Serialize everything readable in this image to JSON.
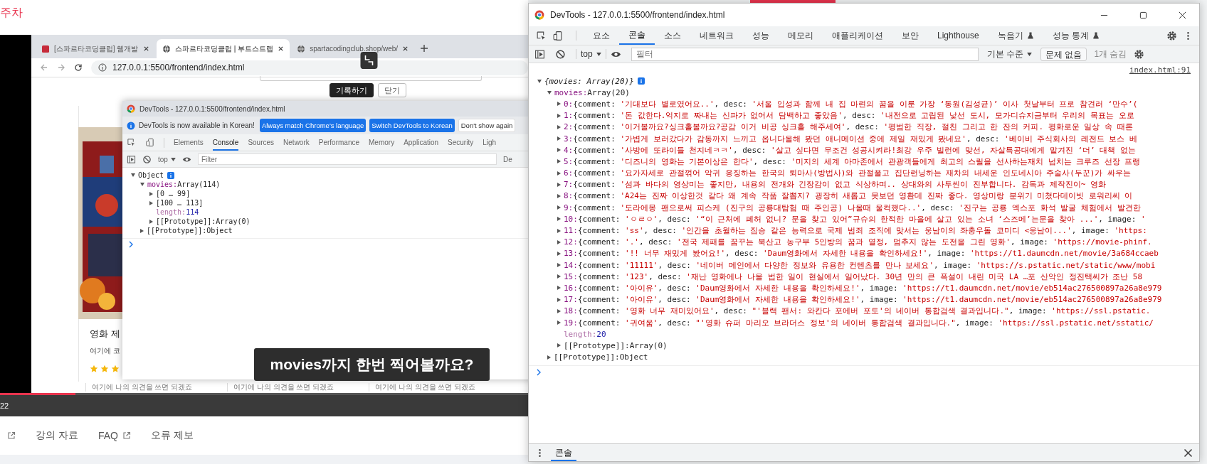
{
  "lecture_header": {
    "title": "주차"
  },
  "video": {
    "browser": {
      "tabs": [
        {
          "label": "[스파르타코딩클럽] 웹개발",
          "selected": false,
          "kind": "book"
        },
        {
          "label": "스파르타코딩클럽 | 부트스트랩",
          "selected": true,
          "kind": "globe"
        },
        {
          "label": "spartacodingclub.shop/web/",
          "selected": false,
          "kind": "globe"
        }
      ],
      "address": "127.0.0.1:5500/frontend/index.html",
      "page": {
        "buttons": [
          {
            "label": "기록하기",
            "kind": "dark"
          },
          {
            "label": "닫기",
            "kind": "light"
          }
        ],
        "card": {
          "title": "영화 제",
          "comment": "여기에 코",
          "stars": 3
        },
        "card_comments": [
          "여기에 나의 의견을 쓰면 되겠죠",
          "여기에 나의 의견을 쓰면 되겠죠",
          "여기에 나의 의견을 쓰면 되겠죠"
        ]
      }
    },
    "inner_devtools": {
      "title": "DevTools - 127.0.0.1:5500/frontend/index.html",
      "notice": "DevTools is now available in Korean!",
      "notice_buttons": [
        {
          "label": "Always match Chrome's language",
          "kind": "primary"
        },
        {
          "label": "Switch DevTools to Korean",
          "kind": "primary"
        },
        {
          "label": "Don't show again",
          "kind": "plain"
        }
      ],
      "tabs": [
        {
          "label": "Elements",
          "selected": false
        },
        {
          "label": "Console",
          "selected": true
        },
        {
          "label": "Sources",
          "selected": false
        },
        {
          "label": "Network",
          "selected": false
        },
        {
          "label": "Performance",
          "selected": false
        },
        {
          "label": "Memory",
          "selected": false
        },
        {
          "label": "Application",
          "selected": false
        },
        {
          "label": "Security",
          "selected": false
        },
        {
          "label": "Ligh",
          "selected": false
        }
      ],
      "context": "top",
      "filter_placeholder": "Filter",
      "levels": "De",
      "tree": [
        {
          "key": "Object",
          "kind": "plain",
          "info": true,
          "expanded": true,
          "children": [
            {
              "key": "movies:",
              "kind": "prop",
              "value": "Array(114)",
              "expanded": true,
              "children": [
                {
                  "key": "[0 … 99]",
                  "kind": "plain",
                  "expanded": false
                },
                {
                  "key": "[100 … 113]",
                  "kind": "plain",
                  "expanded": false
                },
                {
                  "key": "length:",
                  "kind": "meta",
                  "value": "114"
                },
                {
                  "key": "[[Prototype]]:",
                  "kind": "plain",
                  "value": "Array(0)",
                  "expanded": false
                }
              ]
            },
            {
              "key": "[[Prototype]]:",
              "kind": "plain",
              "value": "Object",
              "expanded": false
            }
          ]
        }
      ]
    },
    "caption": "movies까지 한번 찍어볼까요?",
    "progress": {
      "level": 0.143
    },
    "time": "22"
  },
  "footer_links": [
    {
      "label": "강의 자료",
      "external": false
    },
    {
      "label": "FAQ",
      "external": true
    },
    {
      "label": "오류 제보",
      "external": false
    }
  ],
  "devtools": {
    "title": "DevTools - 127.0.0.1:5500/frontend/index.html",
    "tabs": [
      {
        "label": "요소",
        "selected": false,
        "experimental": false
      },
      {
        "label": "콘솔",
        "selected": true,
        "experimental": false
      },
      {
        "label": "소스",
        "selected": false,
        "experimental": false
      },
      {
        "label": "네트워크",
        "selected": false,
        "experimental": false
      },
      {
        "label": "성능",
        "selected": false,
        "experimental": false
      },
      {
        "label": "메모리",
        "selected": false,
        "experimental": false
      },
      {
        "label": "애플리케이션",
        "selected": false,
        "experimental": false
      },
      {
        "label": "보안",
        "selected": false,
        "experimental": false
      },
      {
        "label": "Lighthouse",
        "selected": false,
        "experimental": false
      },
      {
        "label": "녹음기",
        "selected": false,
        "experimental": true
      },
      {
        "label": "성능 통계",
        "selected": false,
        "experimental": true
      }
    ],
    "context": "top",
    "filter_placeholder": "필터",
    "levels": "기본 수준",
    "issues": "문제 없음",
    "hidden": "1개 숨김",
    "source": "index.html:91",
    "tree": [
      {
        "key": "{movies: Array(20)}",
        "kind": "summary",
        "info": true,
        "expanded": true,
        "children": [
          {
            "key": "movies:",
            "kind": "prop",
            "value": "Array(20)",
            "expanded": true,
            "children": [
              {
                "key": "0:",
                "kind": "index",
                "expanded": false,
                "parts": [
                  {
                    "kind": "p",
                    "text": "{comment: "
                  },
                  {
                    "kind": "s",
                    "text": "'기대보다 별로였어요..'"
                  },
                  {
                    "kind": "p",
                    "text": ", desc: "
                  },
                  {
                    "kind": "s",
                    "text": "'서울 입성과 함께 내 집 마련의 꿈을 이룬 가장 ‘동원(김성균)’ 이사 첫날부터 프로 참견러 ‘만수’("
                  }
                ]
              },
              {
                "key": "1:",
                "kind": "index",
                "expanded": false,
                "parts": [
                  {
                    "kind": "p",
                    "text": "{comment: "
                  },
                  {
                    "kind": "s",
                    "text": "'돈 값한다.억지로 짜내는 신파가 없어서 담백하고 좋았음'"
                  },
                  {
                    "kind": "p",
                    "text": ", desc: "
                  },
                  {
                    "kind": "s",
                    "text": "'내전으로 고립된 낯선 도시, 모가디슈지금부터 우리의 목표는 오로"
                  }
                ]
              },
              {
                "key": "2:",
                "kind": "index",
                "expanded": false,
                "parts": [
                  {
                    "kind": "p",
                    "text": "{comment: "
                  },
                  {
                    "kind": "s",
                    "text": "'이거볼까요?싱크홀볼까요?공감 이거 비공 싱크홀 해주세여'"
                  },
                  {
                    "kind": "p",
                    "text": ", desc: "
                  },
                  {
                    "kind": "s",
                    "text": "'평범한 직장, 절친 그리고 한 잔의 커피. 평화로운 일상 속 때론"
                  }
                ]
              },
              {
                "key": "3:",
                "kind": "index",
                "expanded": false,
                "parts": [
                  {
                    "kind": "p",
                    "text": "{comment: "
                  },
                  {
                    "kind": "s",
                    "text": "'가볍게 보러갔다가 감동까지 느끼고 옵니다올해 봤던 애니메이션 중에 제일 재밌게 봤네요'"
                  },
                  {
                    "kind": "p",
                    "text": ", desc: "
                  },
                  {
                    "kind": "s",
                    "text": "'베이비 주식회사의 레전드 보스 베"
                  }
                ]
              },
              {
                "key": "4:",
                "kind": "index",
                "expanded": false,
                "parts": [
                  {
                    "kind": "p",
                    "text": "{comment: "
                  },
                  {
                    "kind": "s",
                    "text": "'사방에 또라이들 천지네ㅋㅋ'"
                  },
                  {
                    "kind": "p",
                    "text": ", desc: "
                  },
                  {
                    "kind": "s",
                    "text": "'살고 싶다면 무조건 성공시켜라!최강 우주 빌런에 맞선, 자살특공대에게 맡겨진 ‘더’ 대책 없는"
                  }
                ]
              },
              {
                "key": "5:",
                "kind": "index",
                "expanded": false,
                "parts": [
                  {
                    "kind": "p",
                    "text": "{comment: "
                  },
                  {
                    "kind": "s",
                    "text": "'디즈니의 영화는 기본이상은 한다'"
                  },
                  {
                    "kind": "p",
                    "text": ", desc: "
                  },
                  {
                    "kind": "s",
                    "text": "'미지의 세계 아마존에서 관광객들에게 최고의 스릴을 선사하는재치 넘치는 크루즈 선장 프랭"
                  }
                ]
              },
              {
                "key": "6:",
                "kind": "index",
                "expanded": false,
                "parts": [
                  {
                    "kind": "p",
                    "text": "{comment: "
                  },
                  {
                    "kind": "s",
                    "text": "'요가자세로 관절꺾어 악귀 응징하는  한국의 퇴마사(방법사)와 관절풀고 집단런닝하는 재차의 내세운 인도네시아 주술사(두꾼)가 싸우는"
                  }
                ]
              },
              {
                "key": "7:",
                "kind": "index",
                "expanded": false,
                "parts": [
                  {
                    "kind": "p",
                    "text": "{comment: "
                  },
                  {
                    "kind": "s",
                    "text": "'섬과  바다의 영상미는  좋지만,  내용의 전개와  긴장감이  없고  식상하며.. 상대와의 사투씬이 진부합니다. 감독과  제작진이~ 영화"
                  }
                ]
              },
              {
                "key": "8:",
                "kind": "index",
                "expanded": false,
                "parts": [
                  {
                    "kind": "p",
                    "text": "{comment: "
                  },
                  {
                    "kind": "s",
                    "text": "'A24는 진짜 이상한것 같다 왜 계속 작품 잘뽑지? 굉장히 새롭고 못보던 영환데 진짜 좋다. 영상미랑 분위기 미쳤다데이빗 로워리씨 이"
                  }
                ]
              },
              {
                "key": "9:",
                "kind": "index",
                "expanded": false,
                "parts": [
                  {
                    "kind": "p",
                    "text": "{comment: "
                  },
                  {
                    "kind": "s",
                    "text": "'도라에몽 팬으로써 피스케 (진구의 공룡대탐험 때 주인공) 나올때 울컥했다..'"
                  },
                  {
                    "kind": "p",
                    "text": ", desc: "
                  },
                  {
                    "kind": "s",
                    "text": "'진구는 공룡 엑스포 화석 발굴 체험에서 발견한"
                  }
                ]
              },
              {
                "key": "10:",
                "kind": "index",
                "expanded": false,
                "parts": [
                  {
                    "kind": "p",
                    "text": "{comment: "
                  },
                  {
                    "kind": "s",
                    "text": "'ㅇㄹㅇ'"
                  },
                  {
                    "kind": "p",
                    "text": ", desc: "
                  },
                  {
                    "kind": "s",
                    "text": "'“이 근처에 폐허 없니? 문을 찾고 있어”규슈의 한적한 마을에 살고 있는 소녀 ‘스즈메’는문을 찾아 ...'"
                  },
                  {
                    "kind": "p",
                    "text": ", image: "
                  },
                  {
                    "kind": "s",
                    "text": "'"
                  }
                ]
              },
              {
                "key": "11:",
                "kind": "index",
                "expanded": false,
                "parts": [
                  {
                    "kind": "p",
                    "text": "{comment: "
                  },
                  {
                    "kind": "s",
                    "text": "'ss'"
                  },
                  {
                    "kind": "p",
                    "text": ", desc: "
                  },
                  {
                    "kind": "s",
                    "text": "'인간을 초월하는 짐승 같은 능력으로 국제 범죄 조직에 맞서는 웅남이의 좌충우돌 코미디 <웅남이...'"
                  },
                  {
                    "kind": "p",
                    "text": ", image: "
                  },
                  {
                    "kind": "s",
                    "text": "'https:"
                  }
                ]
              },
              {
                "key": "12:",
                "kind": "index",
                "expanded": false,
                "parts": [
                  {
                    "kind": "p",
                    "text": "{comment: "
                  },
                  {
                    "kind": "s",
                    "text": "'.'"
                  },
                  {
                    "kind": "p",
                    "text": ", desc: "
                  },
                  {
                    "kind": "s",
                    "text": "'전국 제패를 꿈꾸는 북산고 농구부 5인방의 꿈과 열정, 멈추지 않는 도전을 그린 영화'"
                  },
                  {
                    "kind": "p",
                    "text": ", image: "
                  },
                  {
                    "kind": "s",
                    "text": "'https://movie-phinf."
                  }
                ]
              },
              {
                "key": "13:",
                "kind": "index",
                "expanded": false,
                "parts": [
                  {
                    "kind": "p",
                    "text": "{comment: "
                  },
                  {
                    "kind": "s",
                    "text": "'!! 너무 재밌게 봤어요!'"
                  },
                  {
                    "kind": "p",
                    "text": ", desc: "
                  },
                  {
                    "kind": "s",
                    "text": "'Daum영화에서 자세한 내용을 확인하세요!'"
                  },
                  {
                    "kind": "p",
                    "text": ", image: "
                  },
                  {
                    "kind": "s",
                    "text": "'https://t1.daumcdn.net/movie/3a684ccaeb"
                  }
                ]
              },
              {
                "key": "14:",
                "kind": "index",
                "expanded": false,
                "parts": [
                  {
                    "kind": "p",
                    "text": "{comment: "
                  },
                  {
                    "kind": "s",
                    "text": "'11111'"
                  },
                  {
                    "kind": "p",
                    "text": ", desc: "
                  },
                  {
                    "kind": "s",
                    "text": "'네이버 메인에서 다양한 정보와 유용한 컨텐츠를 만나 보세요'"
                  },
                  {
                    "kind": "p",
                    "text": ", image: "
                  },
                  {
                    "kind": "s",
                    "text": "'https://s.pstatic.net/static/www/mobi"
                  }
                ]
              },
              {
                "key": "15:",
                "kind": "index",
                "expanded": false,
                "parts": [
                  {
                    "kind": "p",
                    "text": "{comment: "
                  },
                  {
                    "kind": "s",
                    "text": "'123'"
                  },
                  {
                    "kind": "p",
                    "text": ", desc: "
                  },
                  {
                    "kind": "s",
                    "text": "'재난 영화에나 나올 법한 일이 현실에서 일어났다. 30년 만의 큰 폭설이 내린 미국 LA …포 산악인 정진택씨가 조난 58"
                  }
                ]
              },
              {
                "key": "16:",
                "kind": "index",
                "expanded": false,
                "parts": [
                  {
                    "kind": "p",
                    "text": "{comment: "
                  },
                  {
                    "kind": "s",
                    "text": "'아이유'"
                  },
                  {
                    "kind": "p",
                    "text": ", desc: "
                  },
                  {
                    "kind": "s",
                    "text": "'Daum영화에서 자세한 내용을 확인하세요!'"
                  },
                  {
                    "kind": "p",
                    "text": ", image: "
                  },
                  {
                    "kind": "s",
                    "text": "'https://t1.daumcdn.net/movie/eb514ac276500897a26a8e979"
                  }
                ]
              },
              {
                "key": "17:",
                "kind": "index",
                "expanded": false,
                "parts": [
                  {
                    "kind": "p",
                    "text": "{comment: "
                  },
                  {
                    "kind": "s",
                    "text": "'아이유'"
                  },
                  {
                    "kind": "p",
                    "text": ", desc: "
                  },
                  {
                    "kind": "s",
                    "text": "'Daum영화에서 자세한 내용을 확인하세요!'"
                  },
                  {
                    "kind": "p",
                    "text": ", image: "
                  },
                  {
                    "kind": "s",
                    "text": "'https://t1.daumcdn.net/movie/eb514ac276500897a26a8e979"
                  }
                ]
              },
              {
                "key": "18:",
                "kind": "index",
                "expanded": false,
                "parts": [
                  {
                    "kind": "p",
                    "text": "{comment: "
                  },
                  {
                    "kind": "s",
                    "text": "'영화 너무 재미있어요'"
                  },
                  {
                    "kind": "p",
                    "text": ", desc: "
                  },
                  {
                    "kind": "s",
                    "text": "\"'블랙 팬서: 와칸다 포에버 포토'의 네이버 통합검색 결과입니다.\""
                  },
                  {
                    "kind": "p",
                    "text": ", image: "
                  },
                  {
                    "kind": "s",
                    "text": "'https://ssl.pstatic."
                  }
                ]
              },
              {
                "key": "19:",
                "kind": "index",
                "expanded": false,
                "parts": [
                  {
                    "kind": "p",
                    "text": "{comment: "
                  },
                  {
                    "kind": "s",
                    "text": "'귀여움'"
                  },
                  {
                    "kind": "p",
                    "text": ", desc: "
                  },
                  {
                    "kind": "s",
                    "text": "\"'영화 슈퍼 마리오 브라더스 정보'의 네이버 통합검색 결과입니다.\""
                  },
                  {
                    "kind": "p",
                    "text": ", image: "
                  },
                  {
                    "kind": "s",
                    "text": "'https://ssl.pstatic.net/sstatic/"
                  }
                ]
              },
              {
                "key": "length:",
                "kind": "meta",
                "value": "20"
              },
              {
                "key": "[[Prototype]]:",
                "kind": "plain",
                "value": "Array(0)",
                "expanded": false
              }
            ]
          },
          {
            "key": "[[Prototype]]:",
            "kind": "plain",
            "value": "Object",
            "expanded": false
          }
        ]
      }
    ],
    "drawer_tab": {
      "label": "콘솔",
      "selected": true
    }
  }
}
